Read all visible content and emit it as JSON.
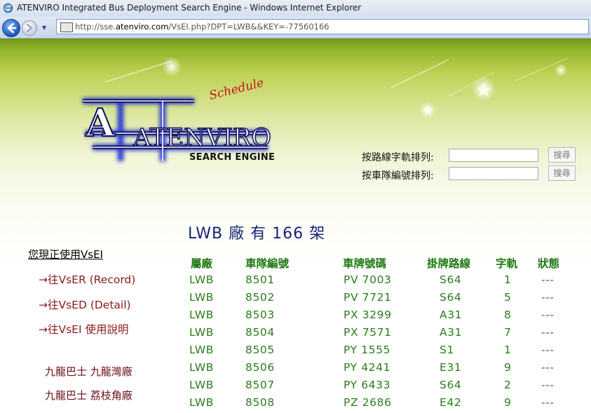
{
  "window": {
    "title": "ATENVIRO Integrated Bus Deployment Search Engine - Windows Internet Explorer",
    "url_prefix": "http://sse.",
    "url_domain": "atenviro.com",
    "url_suffix": "/VsEI.php?DPT=LWB&&KEY=-77560166"
  },
  "logo": {
    "brand": "ATENVIRO",
    "tagline": "Schedule",
    "subtitle": "SEARCH ENGINE"
  },
  "sort": {
    "by_route_label": "按路線字軌排列:",
    "by_fleet_label": "按車隊編號排列:",
    "search_button": "搜尋",
    "route_value": "",
    "fleet_value": ""
  },
  "heading": {
    "depot": "LWB",
    "word_depot": "廠",
    "word_has": "有",
    "count": "166",
    "unit": "架"
  },
  "nav": {
    "current": "您現正使用VsEI",
    "links": [
      "→往VsER (Record)",
      "→往VsED (Detail)",
      "→往VsEI 使用說明"
    ],
    "depots": [
      "九龍巴士 九龍灣廠",
      "九龍巴士 荔枝角廠"
    ]
  },
  "table": {
    "headers": [
      "屬廠",
      "車隊編號",
      "車牌號碼",
      "掛牌路線",
      "字軌",
      "狀態"
    ],
    "rows": [
      [
        "LWB",
        "8501",
        "PV 7003",
        "S64",
        "1",
        "---"
      ],
      [
        "LWB",
        "8502",
        "PV 7721",
        "S64",
        "5",
        "---"
      ],
      [
        "LWB",
        "8503",
        "PX 3299",
        "A31",
        "8",
        "---"
      ],
      [
        "LWB",
        "8504",
        "PX 7571",
        "A31",
        "7",
        "---"
      ],
      [
        "LWB",
        "8505",
        "PY 1555",
        "S1",
        "1",
        "---"
      ],
      [
        "LWB",
        "8506",
        "PY 4241",
        "E31",
        "9",
        "---"
      ],
      [
        "LWB",
        "8507",
        "PY 6433",
        "S64",
        "2",
        "---"
      ],
      [
        "LWB",
        "8508",
        "PZ 2686",
        "E42",
        "9",
        "---"
      ]
    ]
  },
  "colors": {
    "heading": "#152476",
    "table_text": "#2a7d1c",
    "nav_link": "#8a1a1a",
    "logo_glow": "#1c2fd6"
  }
}
